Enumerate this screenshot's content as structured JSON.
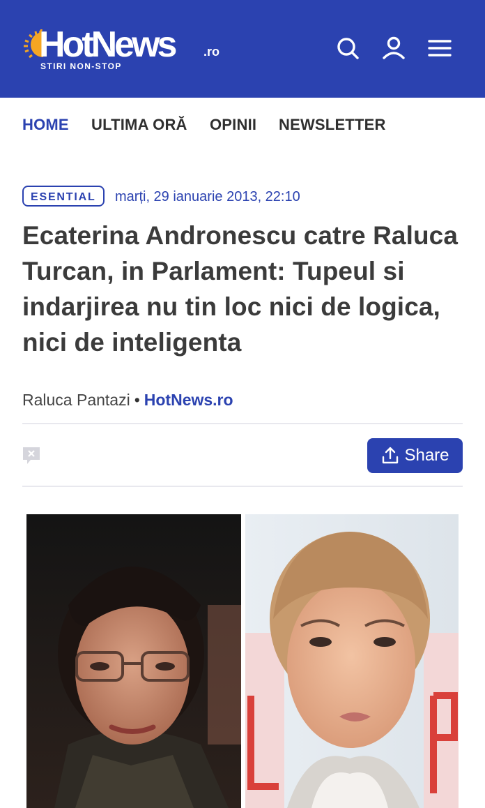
{
  "header": {
    "logo_text": "HotNews",
    "logo_suffix": ".ro",
    "tagline": "STIRI NON-STOP",
    "colors": {
      "brand": "#2b42b0",
      "sun": "#f5a623"
    }
  },
  "nav": {
    "items": [
      {
        "label": "HOME",
        "active": true
      },
      {
        "label": "ULTIMA ORĂ",
        "active": false
      },
      {
        "label": "OPINII",
        "active": false
      },
      {
        "label": "NEWSLETTER",
        "active": false
      }
    ]
  },
  "article": {
    "category": "ESENTIAL",
    "date": "marți, 29 ianuarie 2013, 22:10",
    "title": "Ecaterina Andronescu catre Raluca Turcan, in Parlament: Tupeul si indarjirea nu tin loc nici de logica, nici de inteligenta",
    "author": "Raluca Pantazi",
    "separator": "•",
    "source": "HotNews.ro",
    "share_label": "Share"
  }
}
